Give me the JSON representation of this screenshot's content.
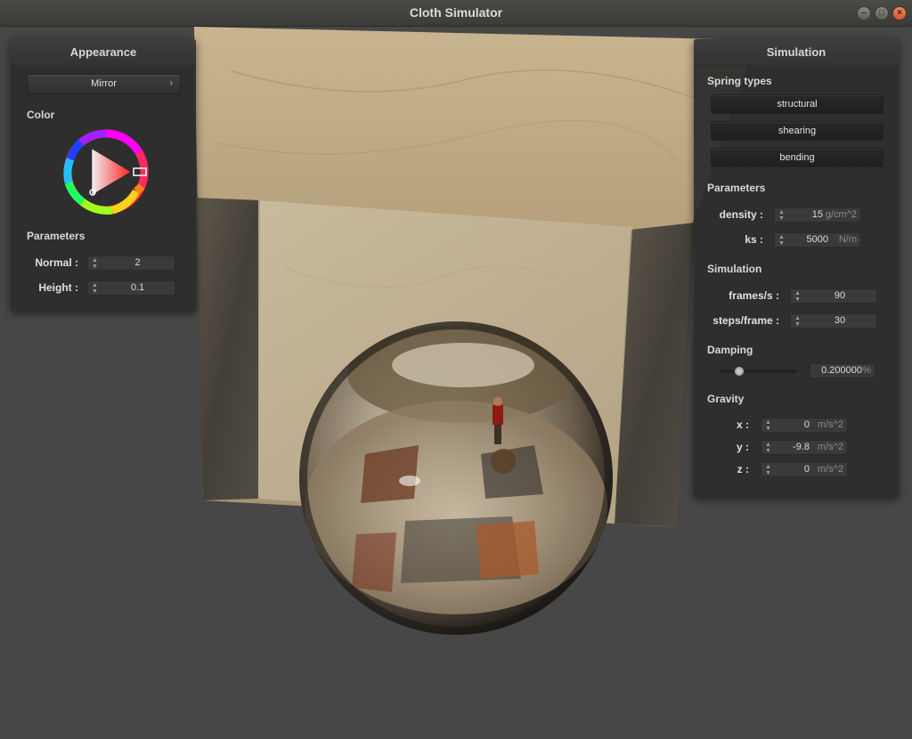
{
  "window": {
    "title": "Cloth Simulator",
    "controls": {
      "minimize": "–",
      "maximize": "□",
      "close": "×"
    }
  },
  "appearance": {
    "header": "Appearance",
    "shader_dropdown": "Mirror",
    "color_label": "Color",
    "parameters_label": "Parameters",
    "normal_label": "Normal :",
    "normal_value": "2",
    "height_label": "Height :",
    "height_value": "0.1"
  },
  "simulation": {
    "header": "Simulation",
    "spring_types_label": "Spring types",
    "spring_buttons": [
      "structural",
      "shearing",
      "bending"
    ],
    "parameters_label": "Parameters",
    "density_label": "density :",
    "density_value": "15",
    "density_unit": "g/cm^2",
    "ks_label": "ks :",
    "ks_value": "5000",
    "ks_unit": "N/m",
    "simulation_label": "Simulation",
    "fps_label": "frames/s :",
    "fps_value": "90",
    "steps_label": "steps/frame :",
    "steps_value": "30",
    "damping_label": "Damping",
    "damping_value": "0.200000",
    "damping_unit": "%",
    "damping_slider_fraction": 0.2,
    "gravity_label": "Gravity",
    "gx_label": "x :",
    "gx_value": "0",
    "gy_label": "y :",
    "gy_value": "-9.8",
    "gz_label": "z :",
    "gz_value": "0",
    "gravity_unit": "m/s^2"
  },
  "colors": {
    "background": "#474747",
    "panel": "#2d2d2d",
    "cloth": "#c9b89a"
  }
}
